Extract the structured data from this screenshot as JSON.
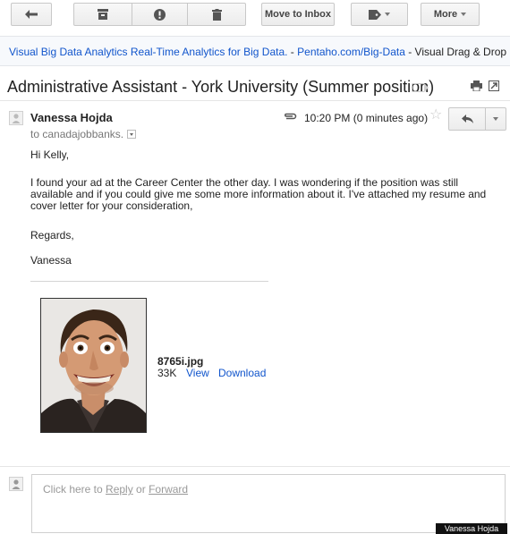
{
  "toolbar": {
    "move_to_inbox_label": "Move to Inbox",
    "more_label": "More"
  },
  "ad": {
    "title": "Visual Big Data Analytics Real-Time Analytics for Big Data.",
    "separator1": " - ",
    "domain": "Pentaho.com/Big-Data",
    "separator2": " - ",
    "snippet": "Visual Drag & Drop U"
  },
  "message": {
    "subject": "Administrative Assistant - York University (Summer position)",
    "sender": "Vanessa Hojda",
    "recipient": "to canadajobbanks.",
    "timestamp": "10:20 PM (0 minutes ago)",
    "greeting": "Hi Kelly,",
    "body": "I found your ad at the Career Center the other day. I was wondering if the position was still available and if you could give me some more information about it. I've attached my resume and cover letter for your consideration,",
    "closing": "Regards,",
    "signature": "Vanessa"
  },
  "attachment": {
    "filename": "8765i.jpg",
    "size": "33K",
    "view_label": "View",
    "download_label": "Download"
  },
  "reply": {
    "prefix": "Click here to ",
    "reply_label": "Reply",
    "or_text": " or ",
    "forward_label": "Forward"
  },
  "photo_credit": "Vanessa Hojda",
  "icons": [
    "back-arrow-icon",
    "archive-icon",
    "report-spam-icon",
    "trash-icon",
    "label-tag-icon",
    "print-icon",
    "new-window-icon",
    "paperclip-icon",
    "star-icon",
    "reply-arrow-icon",
    "person-icon"
  ],
  "colors": {
    "link": "#1155cc",
    "text": "#222222",
    "muted": "#777777"
  }
}
